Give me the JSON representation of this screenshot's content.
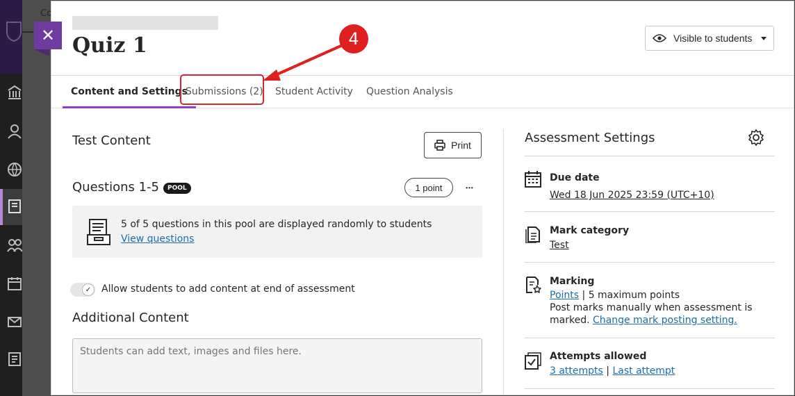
{
  "background": {
    "partial_text": "Co"
  },
  "panel": {
    "title": "Quiz 1",
    "visibility_label": "Visible to students",
    "close_symbol": "✕"
  },
  "tabs": [
    {
      "label": "Content and Settings",
      "active": true
    },
    {
      "label": "Submissions (2)",
      "active": false
    },
    {
      "label": "Student Activity",
      "active": false
    },
    {
      "label": "Question Analysis",
      "active": false
    }
  ],
  "annotation": {
    "step_number": "4",
    "color": "#e02020"
  },
  "test_content": {
    "heading": "Test Content",
    "print_label": "Print",
    "questions_heading": "Questions 1-5",
    "pool_badge": "POOL",
    "points_label": "1 point",
    "more_label": "•••",
    "pool_message": "5 of 5 questions in this pool are displayed randomly to students",
    "view_questions_link": "View questions",
    "allow_content_label": "Allow students to add content at end of assessment",
    "allow_content_enabled": true,
    "additional_content_heading": "Additional Content",
    "additional_content_placeholder": "Students can add text, images and files here."
  },
  "assessment_settings": {
    "heading": "Assessment Settings",
    "due_date": {
      "label": "Due date",
      "value": "Wed 18 Jun 2025 23:59 (UTC+10)"
    },
    "mark_category": {
      "label": "Mark category",
      "value": "Test"
    },
    "marking": {
      "label": "Marking",
      "scheme_link": "Points",
      "separator": "|",
      "max_points": "5 maximum points",
      "posting_text_1": "Post marks manually when assessment is",
      "posting_text_2": "marked.",
      "change_link": "Change mark posting setting."
    },
    "attempts": {
      "label": "Attempts allowed",
      "attempts_link": "3 attempts",
      "separator": "|",
      "last_attempt_link": "Last attempt"
    }
  },
  "colors": {
    "accent_purple": "#8c3ec5",
    "close_button": "#6e3b9f",
    "link_blue": "#1b6ea8",
    "highlight_red": "#d9252f"
  }
}
